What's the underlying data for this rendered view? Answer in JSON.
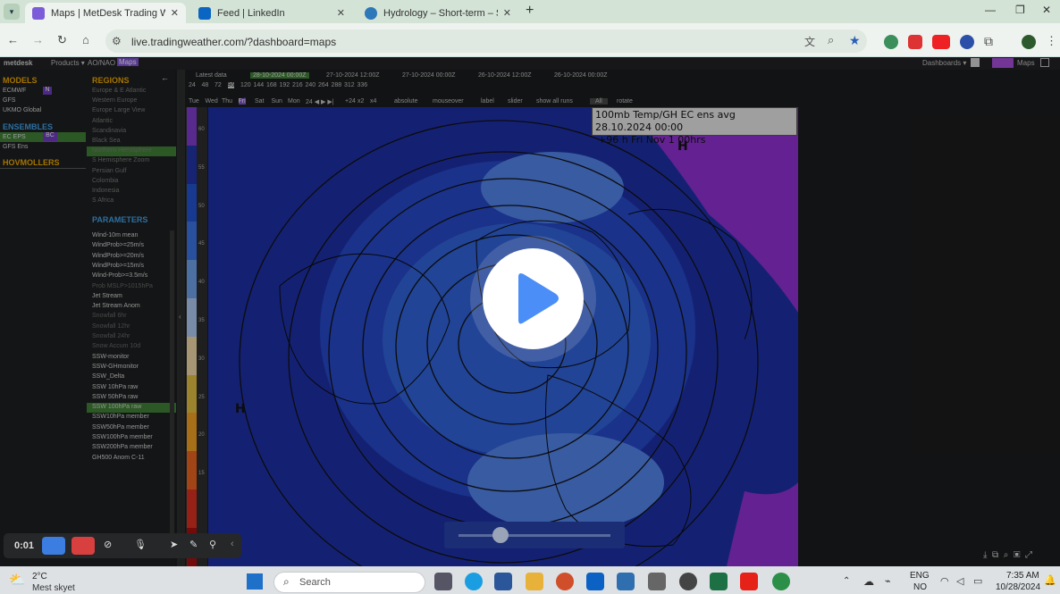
{
  "browser": {
    "tabs": [
      {
        "label": "Maps | MetDesk Trading Weath",
        "active": true
      },
      {
        "label": "Feed | LinkedIn",
        "active": false
      },
      {
        "label": "Hydrology – Short-term – SE2",
        "active": false
      }
    ],
    "url": "live.tradingweather.com/?dashboard=maps"
  },
  "app": {
    "brand": "metdesk",
    "menu": [
      "Products ▾",
      "AO/NAO",
      "Maps"
    ],
    "right_menu": [
      "Dashboards ▾",
      "Maps"
    ],
    "models_title": "MODELS",
    "models": [
      "ECMWF",
      "GFS",
      "UKMO Global"
    ],
    "models_badge": "N",
    "ensembles_title": "ENSEMBLES",
    "ensembles": [
      "EC EPS",
      "GFS Ens"
    ],
    "ensembles_badge": "BC",
    "hovmollers_title": "HOVMOLLERS",
    "regions_title": "REGIONS",
    "regions": [
      "Europe & E Atlantic",
      "Western Europe",
      "Europe Large View",
      "Atlantic",
      "Scandinavia",
      "Black Sea",
      "Northern Hemisphere",
      "S Hemisphere Zoom",
      "Persian Gulf",
      "Colombia",
      "Indonesia",
      "S Africa"
    ],
    "parameters_title": "PARAMETERS",
    "parameters": [
      "Wind-10m mean",
      "WindProb>=25m/s",
      "WindProb>=20m/s",
      "WindProb>=15m/s",
      "Wind-Prob>=3.5m/s",
      "Prob MSLP>1015hPa",
      "Jet Stream",
      "Jet Stream Anom",
      "Snowfall 6hr",
      "Snowfall 12hr",
      "Snowfall 24hr",
      "Snow Accum 10d",
      "SSW-monitor",
      "SSW-GHmonitor",
      "SSW_Delta",
      "SSW 10hPa raw",
      "SSW 50hPa raw",
      "SSW 100hPa raw",
      "SSW10hPa member",
      "SSW50hPa member",
      "SSW100hPa member",
      "SSW200hPa member",
      "GH500 Anom C-11"
    ],
    "run_label": "Latest data",
    "runs": [
      "28-10-2024 00:00Z",
      "27-10-2024 12:00Z",
      "27-10-2024 00:00Z",
      "26-10-2024 12:00Z",
      "26-10-2024 00:00Z"
    ],
    "steps": [
      "24",
      "48",
      "72",
      "96",
      "120",
      "144",
      "168",
      "192",
      "216",
      "240",
      "264",
      "288",
      "312",
      "336"
    ],
    "days": [
      "Tue",
      "Wed",
      "Thu",
      "Fri",
      "Sat",
      "Sun",
      "Mon"
    ],
    "options": [
      "absolute",
      "mouseover",
      "label",
      "slider",
      "show all runs"
    ],
    "all_select": "All",
    "rotate": "rotate",
    "step_extra": [
      "+24",
      "x2",
      "x4"
    ],
    "map_title": "100mb Temp/GH  EC ens avg 28.10.2024 00:00",
    "map_subtitle": "+96 h Fri Nov 1 00hrs",
    "legend_ticks": [
      "60",
      "55",
      "50",
      "45",
      "40",
      "35",
      "30",
      "25",
      "20",
      "15"
    ]
  },
  "recorder": {
    "time": "0:01"
  },
  "taskbar": {
    "weather_temp": "2°C",
    "weather_desc": "Mest skyet",
    "search_placeholder": "Search",
    "lang_1": "ENG",
    "lang_2": "NO",
    "time": "7:35 AM",
    "date": "10/28/2024"
  },
  "colors": {
    "accent_green": "#5aa64a",
    "map_blue": "#1c2fa0",
    "purple": "#8a2fc9"
  }
}
